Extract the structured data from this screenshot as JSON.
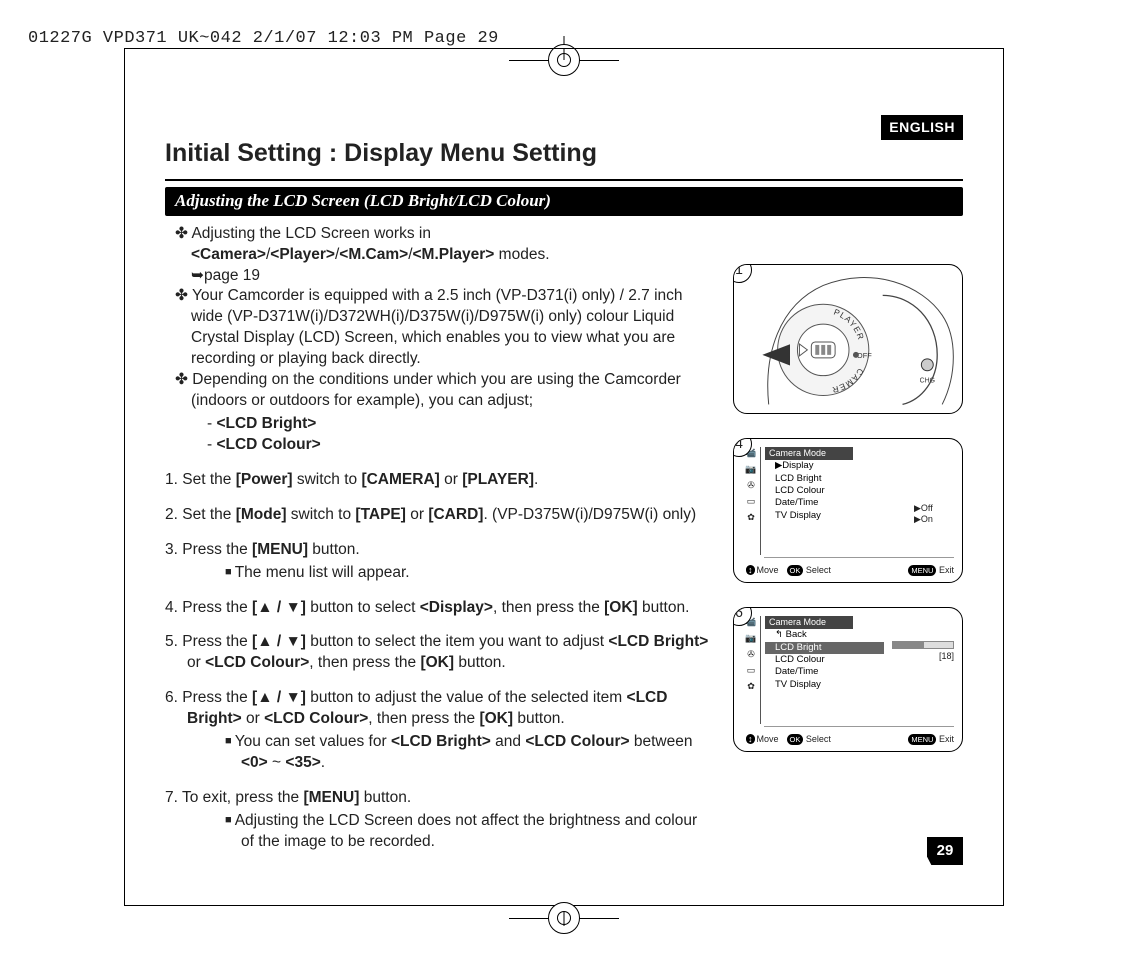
{
  "slug": "01227G VPD371 UK~042  2/1/07 12:03 PM  Page 29",
  "language_badge": "ENGLISH",
  "title": "Initial Setting : Display Menu Setting",
  "subheading": "Adjusting the LCD Screen (LCD Bright/LCD Colour)",
  "page_number": "29",
  "intro": {
    "p1_pre": "✤ Adjusting the LCD Screen works in ",
    "p1_b1": "<Camera>",
    "p1_s1": "/",
    "p1_b2": "<Player>",
    "p1_s2": "/",
    "p1_b3": "<M.Cam>",
    "p1_s3": "/",
    "p1_b4": "<M.Player>",
    "p1_post": " modes.",
    "p1_ref": "➥page 19",
    "p2": "✤ Your Camcorder is equipped with a 2.5 inch (VP-D371(i) only) / 2.7 inch wide (VP-D371W(i)/D372WH(i)/D375W(i)/D975W(i) only) colour Liquid Crystal Display (LCD) Screen, which enables you to view what you are recording or playing back directly.",
    "p3": "✤ Depending on the conditions under which you are using the Camcorder (indoors or outdoors for example), you can adjust;",
    "adj1": "<LCD Bright>",
    "adj2": "<LCD Colour>"
  },
  "steps": {
    "s1": {
      "pre": "Set the ",
      "b1": "[Power]",
      "mid": " switch to ",
      "b2": "[CAMERA]",
      "mid2": " or ",
      "b3": "[PLAYER]",
      "post": "."
    },
    "s2": {
      "pre": "Set the ",
      "b1": "[Mode]",
      "mid": " switch to ",
      "b2": "[TAPE]",
      "mid2": " or ",
      "b3": "[CARD]",
      "post": ". (VP-D375W(i)/D975W(i) only)"
    },
    "s3": {
      "pre": "Press the ",
      "b1": "[MENU]",
      "post": " button.",
      "sub1": "The menu list will appear."
    },
    "s4": {
      "pre": "Press the ",
      "b1": "[▲ / ▼]",
      "mid": " button to select ",
      "b2": "<Display>",
      "mid2": ", then press the ",
      "b3": "[OK]",
      "post": " button."
    },
    "s5": {
      "pre": "Press the ",
      "b1": "[▲ / ▼]",
      "mid": " button to select the item you want to adjust ",
      "b2": "<LCD Bright>",
      "mid2": " or ",
      "b3": "<LCD Colour>",
      "mid3": ", then press the ",
      "b4": "[OK]",
      "post": " button."
    },
    "s6": {
      "pre": "Press the ",
      "b1": "[▲ / ▼]",
      "mid": " button to adjust the value of the selected item ",
      "b2": "<LCD Bright>",
      "mid2": " or ",
      "b3": "<LCD Colour>",
      "mid3": ", then press the ",
      "b4": "[OK]",
      "post": " button.",
      "sub1_pre": "You can set values for ",
      "sub1_b1": "<LCD Bright>",
      "sub1_mid": " and ",
      "sub1_b2": "<LCD Colour>",
      "sub1_mid2": " between ",
      "sub1_b3": "<0>",
      "sub1_mid3": " ~ ",
      "sub1_b4": "<35>",
      "sub1_post": "."
    },
    "s7": {
      "pre": "To exit, press the ",
      "b1": "[MENU]",
      "post": " button.",
      "sub1": "Adjusting the LCD Screen does not affect the brightness and colour of the image to be recorded."
    }
  },
  "fig1": {
    "number": "1",
    "dial": {
      "top": "PLAYER",
      "mid": "OFF",
      "bot": "CAMERA",
      "chg_label": "CHG"
    }
  },
  "fig4": {
    "number": "4",
    "title": "Camera Mode",
    "items": [
      "▶Display",
      "LCD Bright",
      "LCD Colour",
      "Date/Time",
      "TV Display"
    ],
    "side": [
      "▶Off",
      "▶On"
    ],
    "hints": {
      "move": "Move",
      "select": "Select",
      "exit": "Exit",
      "ok": "OK",
      "menu": "MENU"
    }
  },
  "fig6": {
    "number": "6",
    "title": "Camera Mode",
    "back": "Back",
    "items": [
      "LCD Bright",
      "LCD Colour",
      "Date/Time",
      "TV Display"
    ],
    "value": "[18]",
    "hints": {
      "move": "Move",
      "select": "Select",
      "exit": "Exit",
      "ok": "OK",
      "menu": "MENU"
    }
  }
}
